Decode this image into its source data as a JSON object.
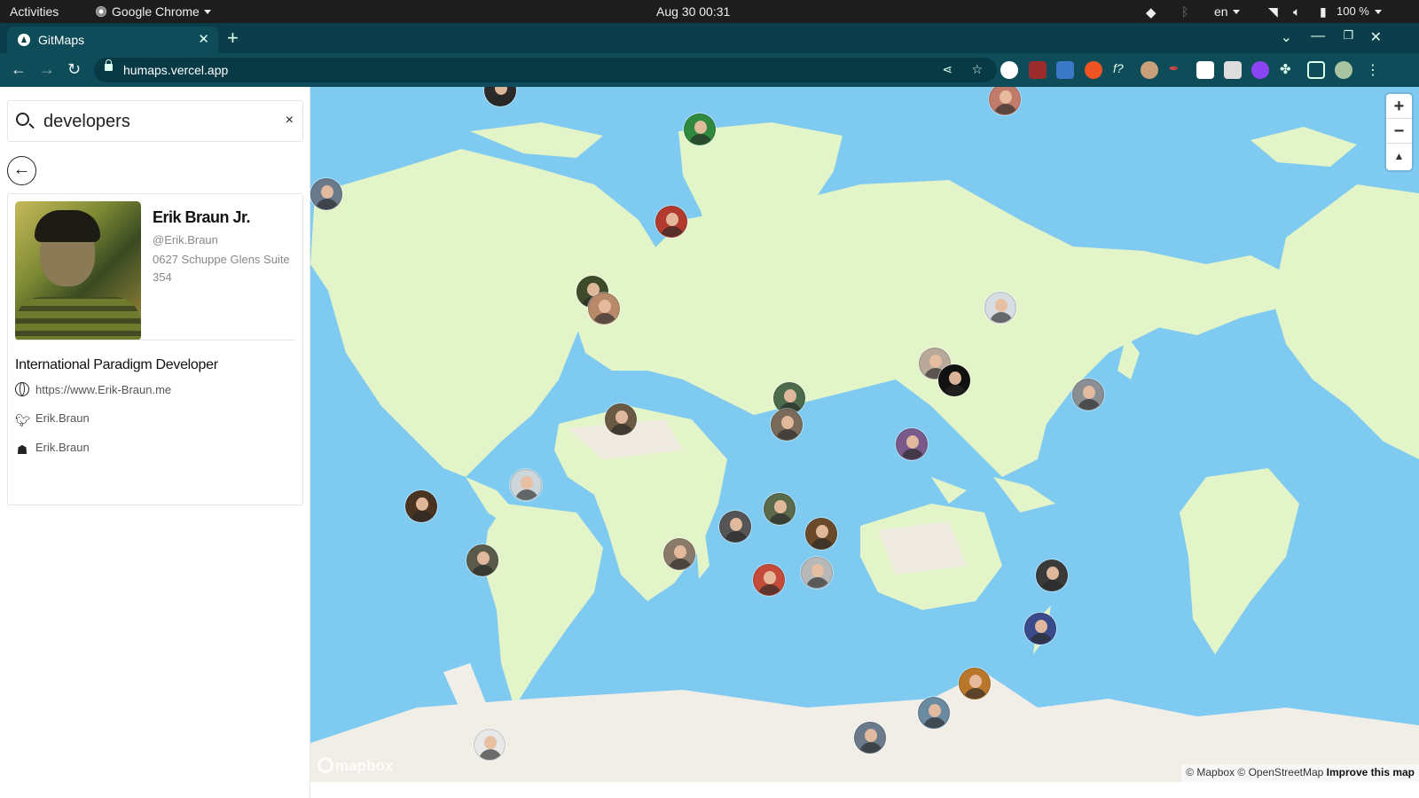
{
  "topbar": {
    "activities": "Activities",
    "app_name": "Google Chrome",
    "datetime": "Aug 30  00:31",
    "language": "en",
    "battery": "100 %"
  },
  "browser": {
    "tab_title": "GitMaps",
    "url": "humaps.vercel.app"
  },
  "sidebar": {
    "search_value": "developers",
    "clear_label": "×",
    "profile": {
      "name": "Erik Braun Jr.",
      "handle": "@Erik.Braun",
      "address": "0627 Schuppe Glens Suite 354",
      "job_title": "International Paradigm Developer",
      "website": "https://www.Erik-Braun.me",
      "twitter": "Erik.Braun",
      "github": "Erik.Braun"
    }
  },
  "map": {
    "zoom_in": "+",
    "zoom_out": "−",
    "compass": "▲",
    "logo": "mapbox",
    "attribution": "© Mapbox © OpenStreetMap",
    "improve": "Improve this map",
    "colors": {
      "water": "#7fcaf1",
      "land": "#e2f4c8",
      "ice": "#f1eee8"
    }
  }
}
